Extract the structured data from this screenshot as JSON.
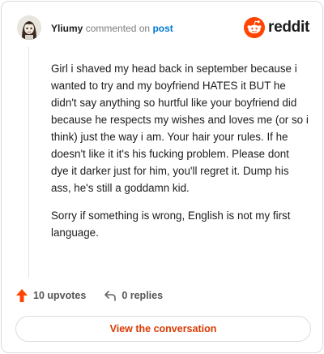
{
  "comment": {
    "username": "Yliumy",
    "action_text": "commented on",
    "target_link": "post",
    "paragraphs": [
      "Girl i shaved my head back in september because i wanted to try and my boyfriend HATES it BUT he didn't say anything so hurtful like your boyfriend did because he respects my wishes and loves me (or so i think) just the way i am. Your hair your rules. If he doesn't like it it's his fucking problem. Please dont dye it darker just for him, you'll regret it. Dump his ass, he's still a goddamn kid.",
      "Sorry if something is wrong, English is not my first language."
    ]
  },
  "brand": {
    "logo_text": "reddit",
    "logo_icon": "reddit-snoo-icon",
    "accent_color": "#ff4500"
  },
  "actions": {
    "upvotes_label": "10 upvotes",
    "replies_label": "0 replies",
    "upvote_icon": "upvote-arrow-icon",
    "reply_icon": "reply-arrow-icon",
    "upvote_color": "#ff4500"
  },
  "cta": {
    "label": "View the conversation",
    "color": "#d93900"
  }
}
